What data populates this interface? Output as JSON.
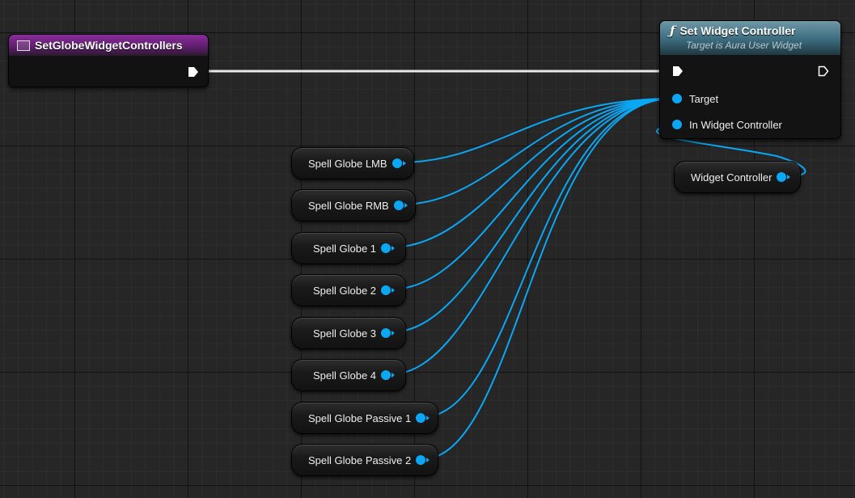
{
  "event_node": {
    "title": "SetGlobeWidgetControllers",
    "icon": "event-box-icon"
  },
  "function_node": {
    "title": "Set Widget Controller",
    "subtitle": "Target is Aura User Widget",
    "icon": "function-icon",
    "pins": {
      "target": "Target",
      "in_widget_controller": "In Widget Controller"
    }
  },
  "variables": [
    {
      "label": "Spell Globe LMB"
    },
    {
      "label": "Spell Globe RMB"
    },
    {
      "label": "Spell Globe 1"
    },
    {
      "label": "Spell Globe 2"
    },
    {
      "label": "Spell Globe 3"
    },
    {
      "label": "Spell Globe 4"
    },
    {
      "label": "Spell Globe Passive 1"
    },
    {
      "label": "Spell Globe Passive 2"
    }
  ],
  "widget_controller_var": {
    "label": "Widget Controller"
  },
  "colors": {
    "object_wire": "#0aa7f5",
    "exec_wire": "#ffffff",
    "event_header": "#8a2d9c",
    "function_header": "#3b6b7d"
  }
}
